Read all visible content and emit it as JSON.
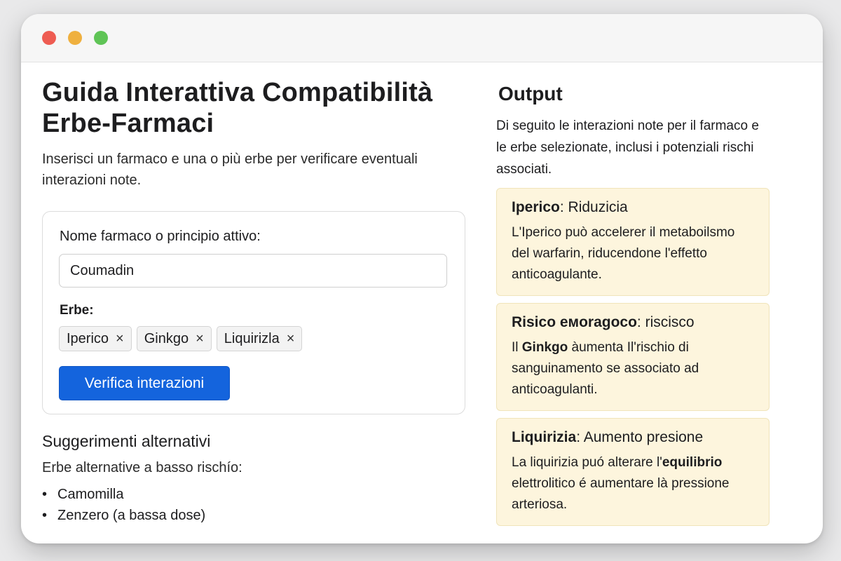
{
  "window": {
    "controls": [
      "close",
      "minimize",
      "maximize"
    ]
  },
  "header": {
    "title": "Guida Interattiva Compatibilità Erbe-Farmaci",
    "subtitle": "Inserisci un farmaco e una o più erbe per verificare eventuali interazioni note."
  },
  "form": {
    "drug_label": "Nome farmaco o principio attivo:",
    "drug_value": "Coumadin",
    "herbs_label": "Erbe:",
    "herbs": [
      {
        "label": "Iperico",
        "remove": "×"
      },
      {
        "label": "Ginkgo",
        "remove": "×"
      },
      {
        "label": "Liquirizla",
        "remove": "×"
      }
    ],
    "submit_label": "Verifica interazioni"
  },
  "alternatives": {
    "title": "Suggerimenti alternativi",
    "subtitle": "Erbe alternative a basso rischío:",
    "items": [
      "Camomilla",
      "Zenzero (a bassa dose)"
    ]
  },
  "output": {
    "title": "Output",
    "description": "Di seguito le interazioni note per il farmaco e le erbe selezionate, inclusi i potenziali rischi associati.",
    "interactions": [
      {
        "name": "Iperico",
        "separator": ": ",
        "effect": "Riduzicia",
        "text": "L'Iperico può accelerer il metaboilsmo del warfarin, riducendone l'effetto anticoagulante."
      },
      {
        "name": "Risico eмoragoco",
        "separator": ": ",
        "effect": "riscisco",
        "text_pre": "Il ",
        "text_bold": "Ginkgo",
        "text_post": " àumenta Il'rischio di sanguinamento se associato ad anticoagulanti."
      },
      {
        "name": "Liquirizia",
        "separator": ": ",
        "effect": "Aumento presione",
        "text_pre": "La liquirizia puó alterare l'",
        "text_bold": "equilibrio",
        "text_post": " elettrolitico é aumentare là pressione arteriosa."
      }
    ]
  },
  "colors": {
    "accent": "#1464dd",
    "card_background": "#fdf5dd",
    "close": "#ee5c52",
    "minimize": "#efb03f",
    "maximize": "#5fc456"
  }
}
